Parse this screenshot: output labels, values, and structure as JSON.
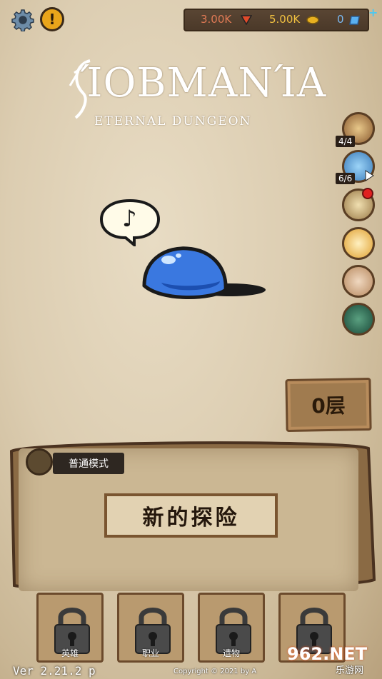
{
  "header": {
    "settings_icon": "gear-icon",
    "alert_icon": "exclamation-icon",
    "alert_symbol": "!",
    "currency": {
      "red": "3.00K",
      "gold": "5.00K",
      "blue": "0",
      "plus": "+"
    }
  },
  "logo": {
    "title": "ΊOBMANΊA",
    "subtitle": "ETERNAL DUNGEON"
  },
  "side_menu": {
    "quest_count": "4/4",
    "crystal_count": "6/6"
  },
  "speech_bubble": {
    "symbol": "♪"
  },
  "floor": {
    "label": "0层"
  },
  "panel": {
    "mode_label": "普通模式",
    "start_label": "新的探险"
  },
  "tabs": [
    {
      "label": "英雄"
    },
    {
      "label": "职业"
    },
    {
      "label": "遗物"
    },
    {
      "label": ""
    }
  ],
  "footer": {
    "version": "Ver 2.21.2 p",
    "copyright": "Copyright © 2021 by A",
    "watermark_main": "962.NET",
    "watermark_sub": "乐游网"
  },
  "colors": {
    "background": "#dccdb1",
    "panel": "#cbb793",
    "slime": "#3a78e0",
    "accent_gold": "#f0c040"
  }
}
